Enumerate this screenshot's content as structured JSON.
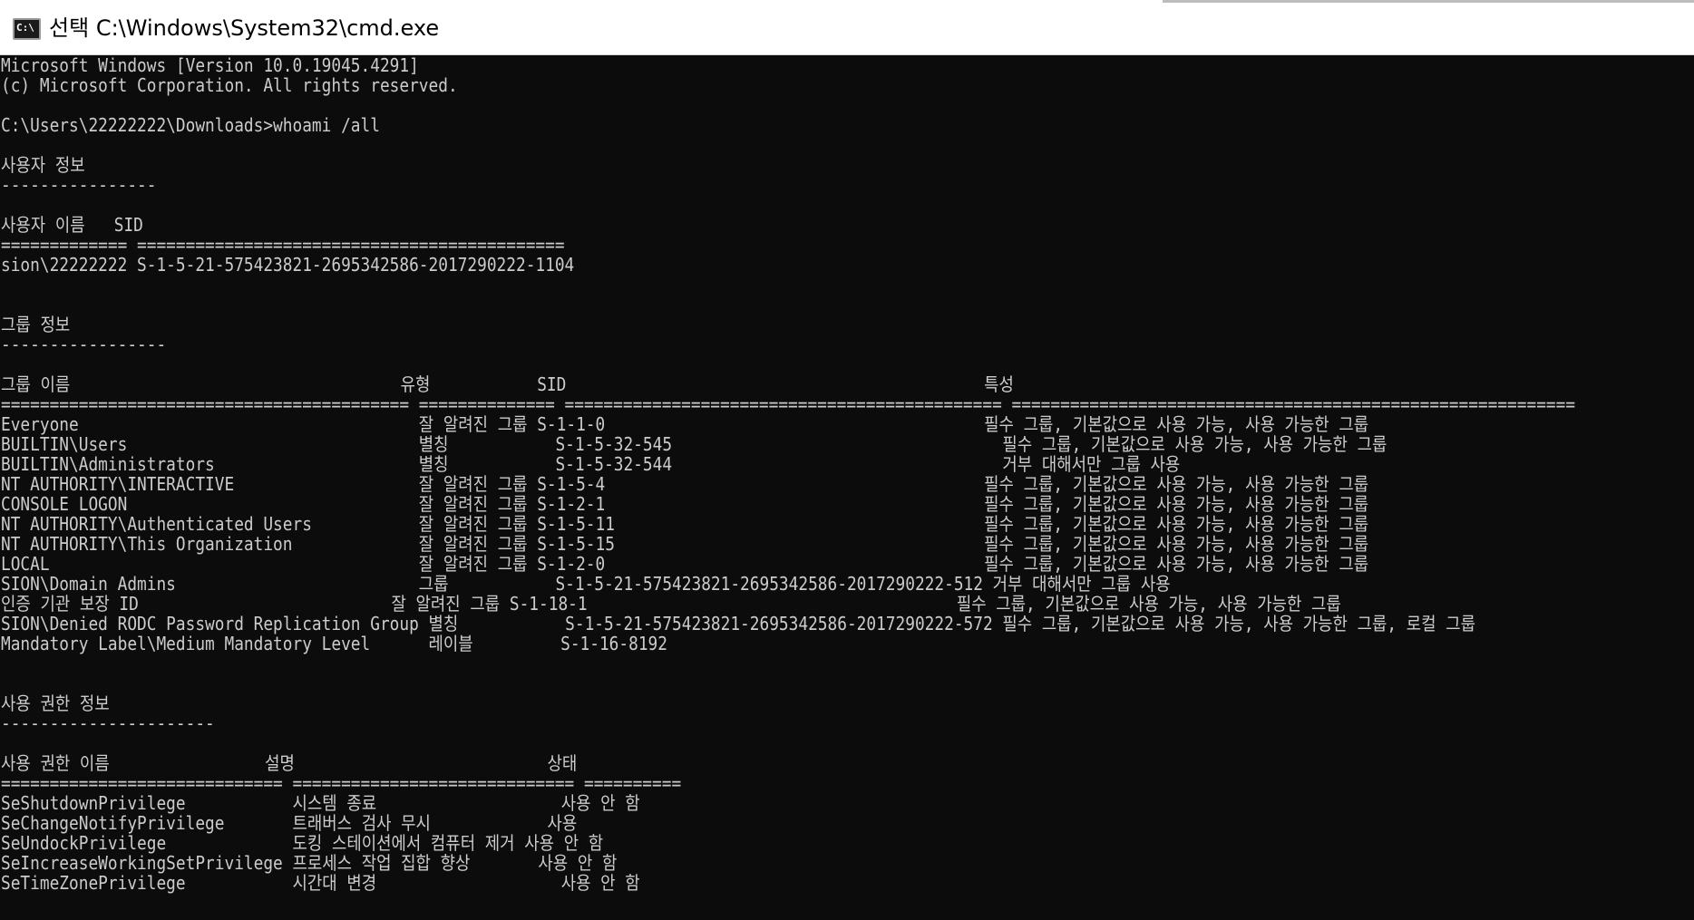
{
  "window": {
    "title_prefix": "선택",
    "title_path": "C:\\Windows\\System32\\cmd.exe",
    "icon": "cmd-icon",
    "icon_text": "C:\\"
  },
  "colors": {
    "console_background": "#0c0c0c",
    "console_text": "#cccccc",
    "titlebar_background": "#ffffff"
  },
  "console": {
    "lines": [
      "Microsoft Windows [Version 10.0.19045.4291]",
      "(c) Microsoft Corporation. All rights reserved.",
      "",
      "C:\\Users\\22222222\\Downloads>whoami /all",
      "",
      "사용자 정보",
      "----------------",
      "",
      "사용자 이름   SID",
      "============= ============================================",
      "sion\\22222222 S-1-5-21-575423821-2695342586-2017290222-1104",
      "",
      "",
      "그룹 정보",
      "-----------------",
      "",
      "그룹 이름                                  유형           SID                                           특성",
      "========================================== ============== ============================================= ==========================================================",
      "Everyone                                   잘 알려진 그룹 S-1-1-0                                       필수 그룹, 기본값으로 사용 가능, 사용 가능한 그룹",
      "BUILTIN\\Users                              별칭           S-1-5-32-545                                  필수 그룹, 기본값으로 사용 가능, 사용 가능한 그룹",
      "BUILTIN\\Administrators                     별칭           S-1-5-32-544                                  거부 대해서만 그룹 사용",
      "NT AUTHORITY\\INTERACTIVE                   잘 알려진 그룹 S-1-5-4                                       필수 그룹, 기본값으로 사용 가능, 사용 가능한 그룹",
      "CONSOLE LOGON                              잘 알려진 그룹 S-1-2-1                                       필수 그룹, 기본값으로 사용 가능, 사용 가능한 그룹",
      "NT AUTHORITY\\Authenticated Users           잘 알려진 그룹 S-1-5-11                                      필수 그룹, 기본값으로 사용 가능, 사용 가능한 그룹",
      "NT AUTHORITY\\This Organization             잘 알려진 그룹 S-1-5-15                                      필수 그룹, 기본값으로 사용 가능, 사용 가능한 그룹",
      "LOCAL                                      잘 알려진 그룹 S-1-2-0                                       필수 그룹, 기본값으로 사용 가능, 사용 가능한 그룹",
      "SION\\Domain Admins                         그룹           S-1-5-21-575423821-2695342586-2017290222-512 거부 대해서만 그룹 사용",
      "인증 기관 보장 ID                          잘 알려진 그룹 S-1-18-1                                      필수 그룹, 기본값으로 사용 가능, 사용 가능한 그룹",
      "SION\\Denied RODC Password Replication Group 별칭           S-1-5-21-575423821-2695342586-2017290222-572 필수 그룹, 기본값으로 사용 가능, 사용 가능한 그룹, 로컬 그룹",
      "Mandatory Label\\Medium Mandatory Level      레이블         S-1-16-8192",
      "",
      "",
      "사용 권한 정보",
      "----------------------",
      "",
      "사용 권한 이름                설명                          상태",
      "============================= ============================= ==========",
      "SeShutdownPrivilege           시스템 종료                   사용 안 함",
      "SeChangeNotifyPrivilege       트래버스 검사 무시            사용",
      "SeUndockPrivilege             도킹 스테이션에서 컴퓨터 제거 사용 안 함",
      "SeIncreaseWorkingSetPrivilege 프로세스 작업 집합 향상       사용 안 함",
      "SeTimeZonePrivilege           시간대 변경                   사용 안 함"
    ]
  }
}
